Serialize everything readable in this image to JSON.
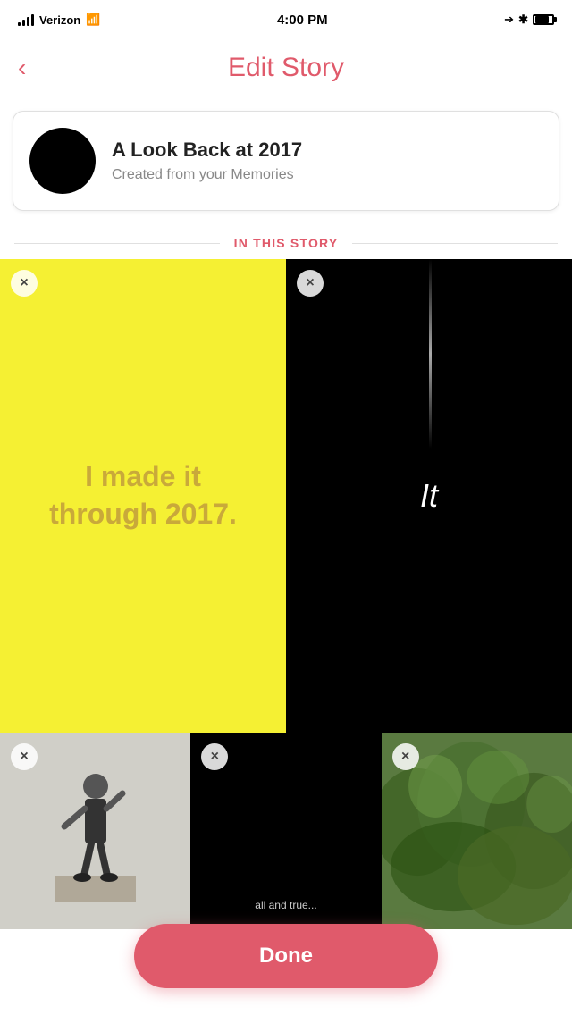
{
  "statusBar": {
    "carrier": "Verizon",
    "time": "4:00 PM",
    "wifiVisible": true,
    "batteryPercent": 75
  },
  "navBar": {
    "backLabel": "‹",
    "title": "Edit Story"
  },
  "storyHeader": {
    "avatarAlt": "Story avatar",
    "title": "A Look Back at 2017",
    "subtitle": "Created from your Memories"
  },
  "sectionLabel": "IN THIS STORY",
  "storyItems": [
    {
      "id": "item-1",
      "type": "yellow-text",
      "text": "I made it through 2017.",
      "bg": "#f5f033",
      "removable": true
    },
    {
      "id": "item-2",
      "type": "black-text",
      "text": "It",
      "bg": "#000000",
      "removable": true
    },
    {
      "id": "item-3",
      "type": "photo-person",
      "bg": "#d0cfc8",
      "removable": true
    },
    {
      "id": "item-4",
      "type": "black-small",
      "text": "all and true...",
      "bg": "#000000",
      "removable": true
    },
    {
      "id": "item-5",
      "type": "nature-photo",
      "bg": "#5a7a4a",
      "removable": true
    }
  ],
  "removeButtonLabel": "×",
  "doneButton": {
    "label": "Done"
  },
  "colors": {
    "accent": "#e05a6b",
    "yellowBg": "#f5f033",
    "yellowText": "#c9a93a",
    "black": "#000000"
  }
}
